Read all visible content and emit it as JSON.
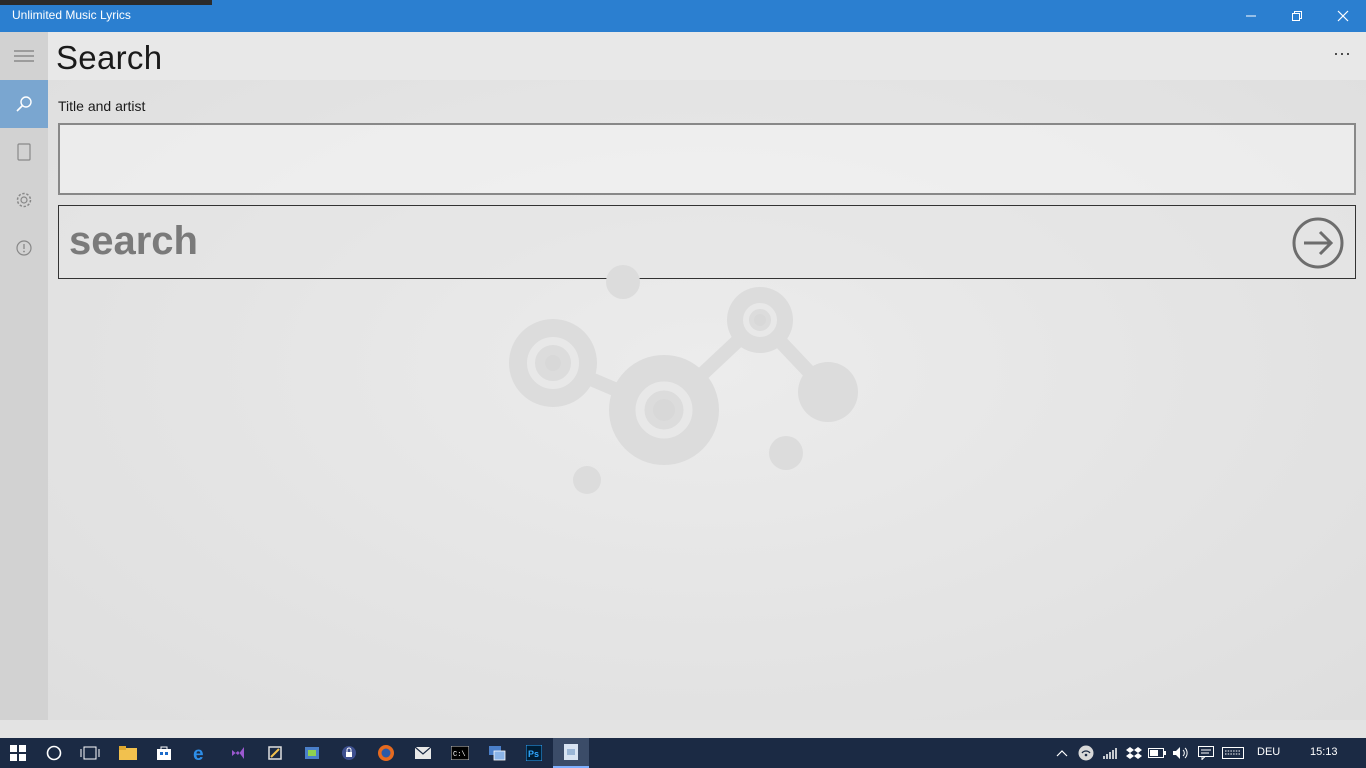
{
  "window": {
    "title": "Unlimited Music Lyrics"
  },
  "header": {
    "page_title": "Search",
    "more_label": "···"
  },
  "nav": {
    "items": [
      {
        "icon": "hamburger-icon"
      },
      {
        "icon": "search-icon",
        "active": true
      },
      {
        "icon": "page-icon"
      },
      {
        "icon": "gear-icon"
      },
      {
        "icon": "info-icon"
      }
    ]
  },
  "search": {
    "label": "Title and artist",
    "value": "",
    "placeholder": "",
    "button_label": "search"
  },
  "taskbar": {
    "language": "DEU",
    "time": "15:13"
  },
  "colors": {
    "titlebar": "#2b7fd0",
    "nav_active": "#7aa6d0",
    "taskbar": "#1b2a44"
  }
}
